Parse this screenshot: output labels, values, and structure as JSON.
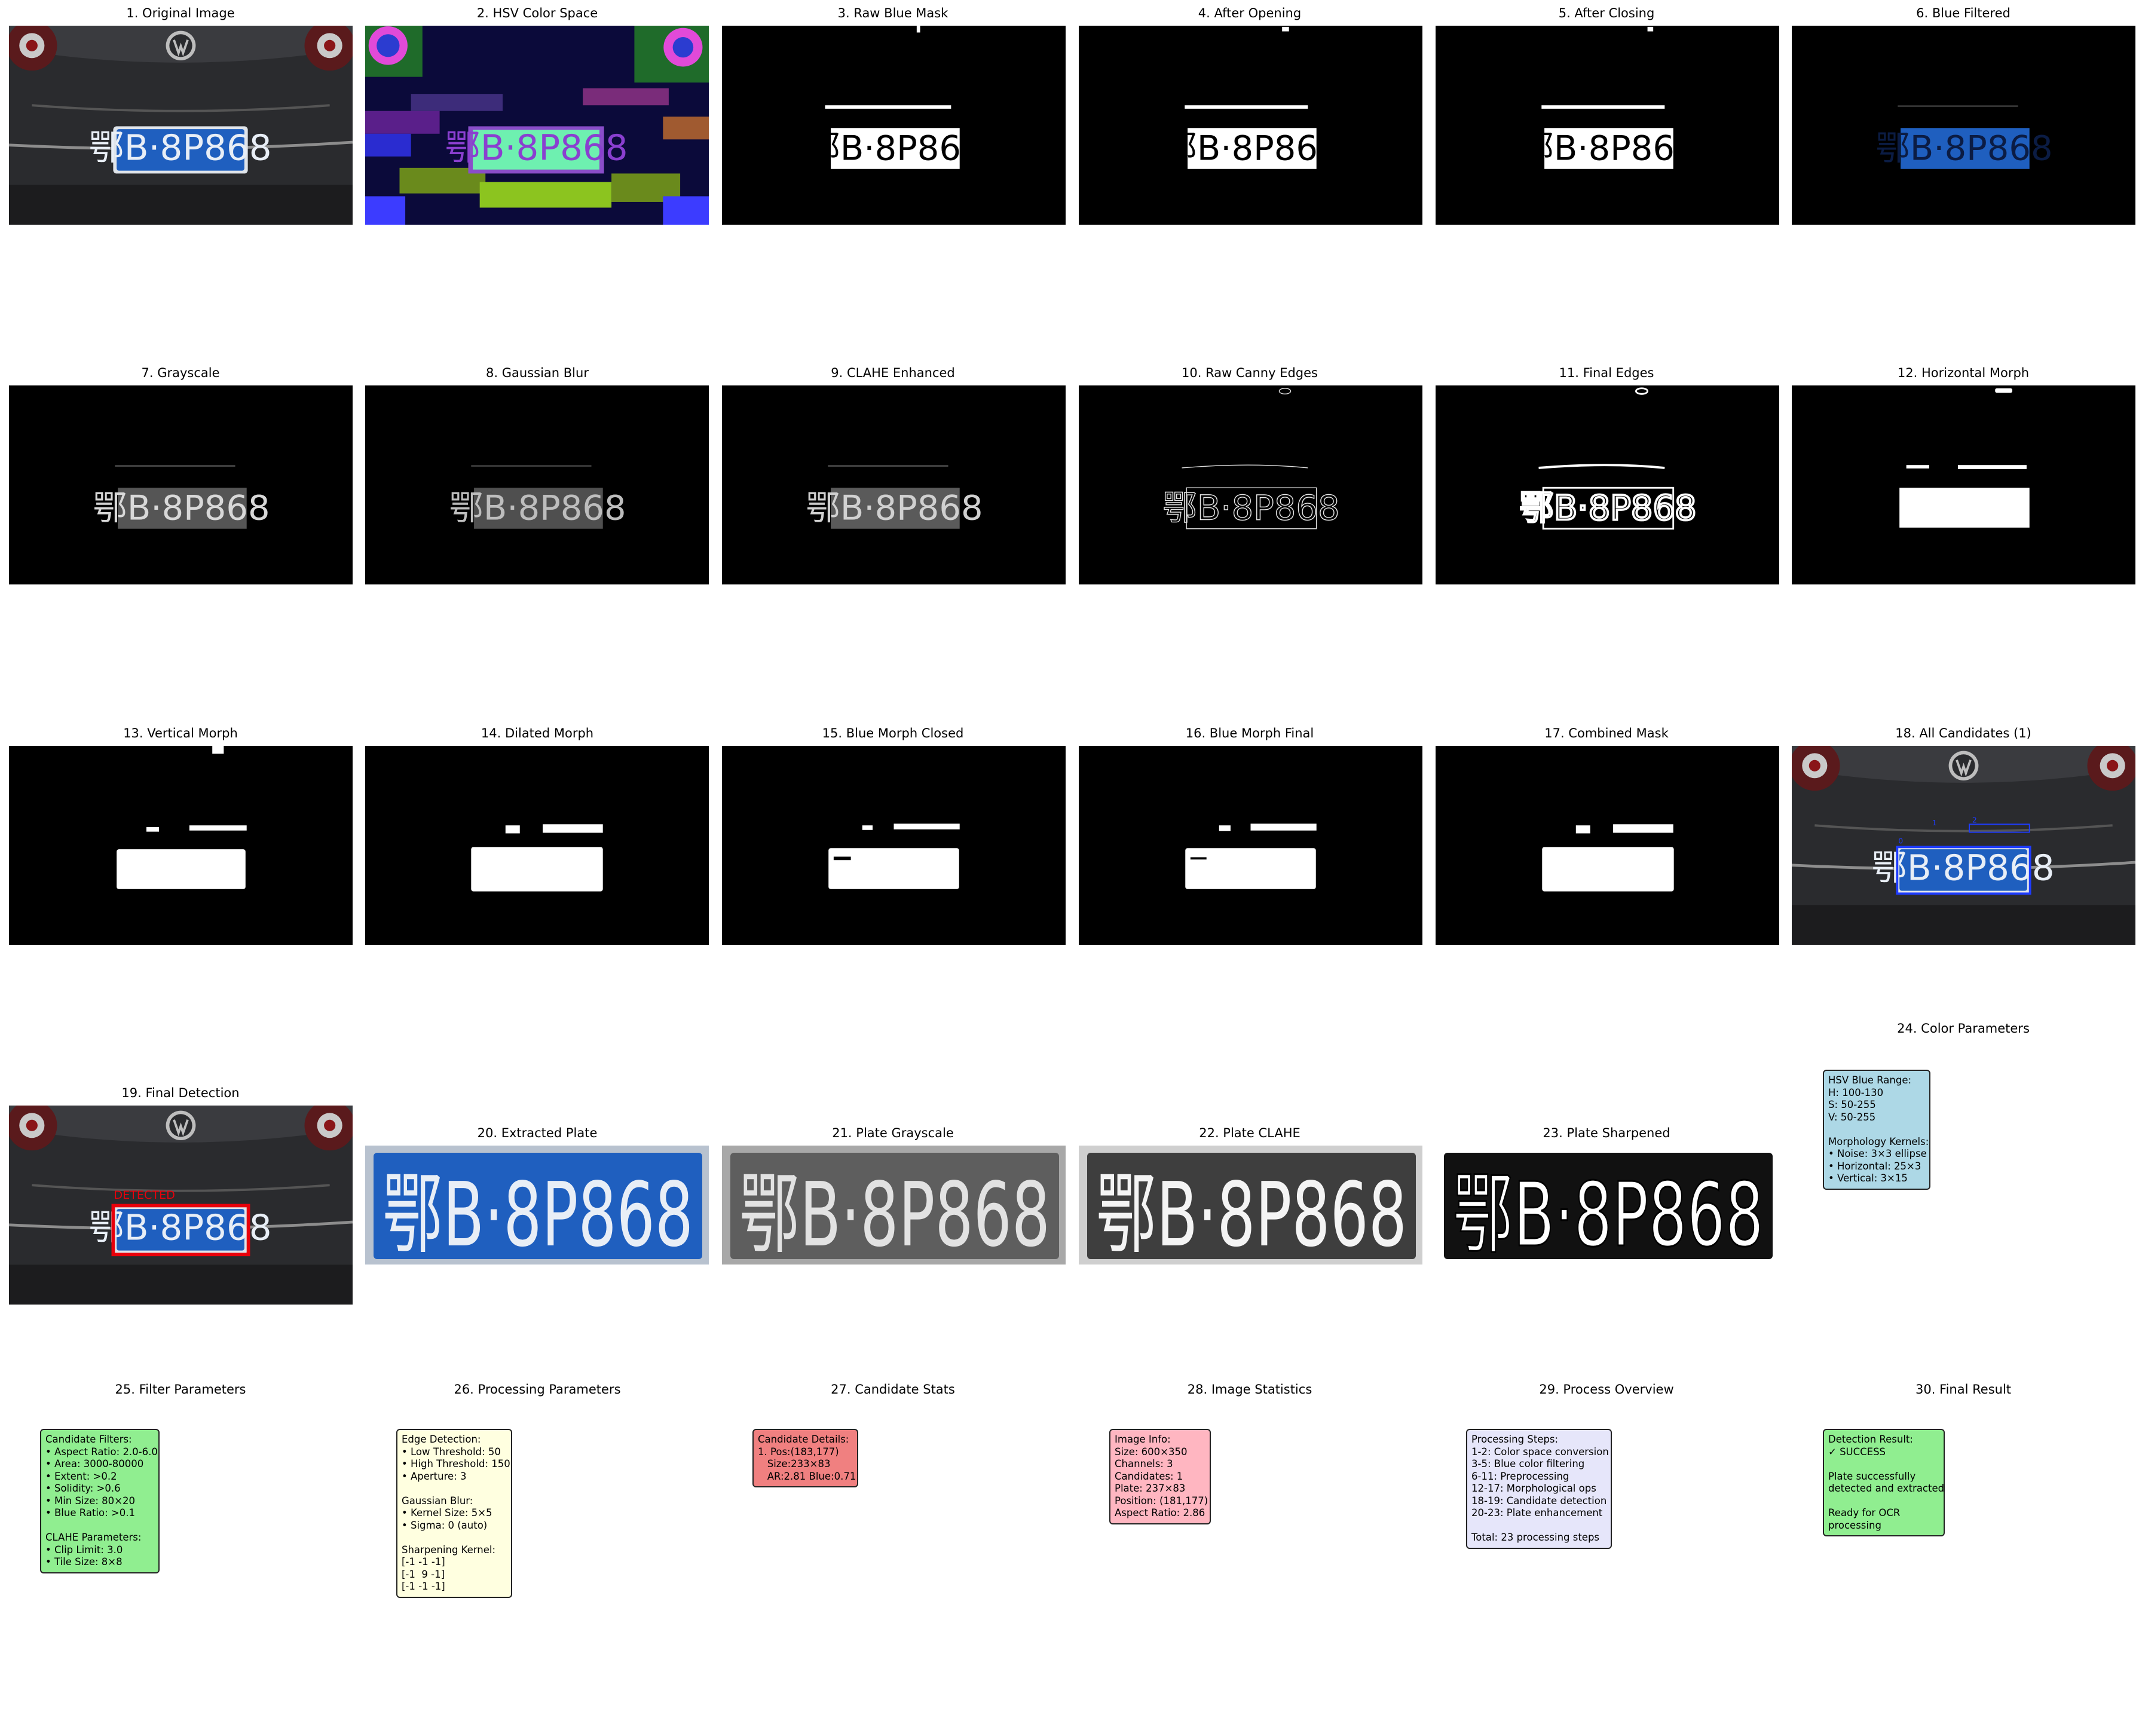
{
  "panels": {
    "p1": "1. Original Image",
    "p2": "2. HSV Color Space",
    "p3": "3. Raw Blue Mask",
    "p4": "4. After Opening",
    "p5": "5. After Closing",
    "p6": "6. Blue Filtered",
    "p7": "7. Grayscale",
    "p8": "8. Gaussian Blur",
    "p9": "9. CLAHE Enhanced",
    "p10": "10. Raw Canny Edges",
    "p11": "11. Final Edges",
    "p12": "12. Horizontal Morph",
    "p13": "13. Vertical Morph",
    "p14": "14. Dilated Morph",
    "p15": "15. Blue Morph Closed",
    "p16": "16. Blue Morph Final",
    "p17": "17. Combined Mask",
    "p18": "18. All Candidates (1)",
    "p19": "19. Final Detection",
    "p20": "20. Extracted Plate",
    "p21": "21. Plate Grayscale",
    "p22": "22. Plate CLAHE",
    "p23": "23. Plate Sharpened",
    "p24": "24. Color Parameters",
    "p25": "25. Filter Parameters",
    "p26": "26. Processing Parameters",
    "p27": "27. Candidate Stats",
    "p28": "28. Image Statistics",
    "p29": "29. Process Overview",
    "p30": "30. Final Result"
  },
  "plate_text": "鄂B·8P868",
  "detected_label": "DETECTED",
  "candidate_labels": [
    "1",
    "2",
    "0"
  ],
  "boxes": {
    "color_params": "HSV Blue Range:\nH: 100-130\nS: 50-255\nV: 50-255\n\nMorphology Kernels:\n• Noise: 3×3 ellipse\n• Horizontal: 25×3\n• Vertical: 3×15",
    "filter_params": "Candidate Filters:\n• Aspect Ratio: 2.0-6.0\n• Area: 3000-80000\n• Extent: >0.2\n• Solidity: >0.6\n• Min Size: 80×20\n• Blue Ratio: >0.1\n\nCLAHE Parameters:\n• Clip Limit: 3.0\n• Tile Size: 8×8",
    "processing_params": "Edge Detection:\n• Low Threshold: 50\n• High Threshold: 150\n• Aperture: 3\n\nGaussian Blur:\n• Kernel Size: 5×5\n• Sigma: 0 (auto)\n\nSharpening Kernel:\n[-1 -1 -1]\n[-1  9 -1]\n[-1 -1 -1]",
    "candidate_stats": "Candidate Details:\n1. Pos:(183,177)\n   Size:233×83\n   AR:2.81 Blue:0.71",
    "image_stats": "Image Info:\nSize: 600×350\nChannels: 3\nCandidates: 1\nPlate: 237×83\nPosition: (181,177)\nAspect Ratio: 2.86",
    "process_overview": "Processing Steps:\n1-2: Color space conversion\n3-5: Blue color filtering\n6-11: Preprocessing\n12-17: Morphological ops\n18-19: Candidate detection\n20-23: Plate enhancement\n\nTotal: 23 processing steps",
    "final_result": "Detection Result:\n✓ SUCCESS\n\nPlate successfully\ndetected and extracted\n\nReady for OCR\nprocessing"
  },
  "colors": {
    "color_params_bg": "#add8e6",
    "filter_params_bg": "#90ee90",
    "processing_params_bg": "#ffffe0",
    "candidate_stats_bg": "#f08080",
    "image_stats_bg": "#ffb6c1",
    "process_overview_bg": "#e6e6fa",
    "final_result_bg": "#90ee90",
    "plate_blue": "#1f5fbf",
    "detection_red": "#e8000b",
    "candidate_blue": "#1e3cff"
  }
}
